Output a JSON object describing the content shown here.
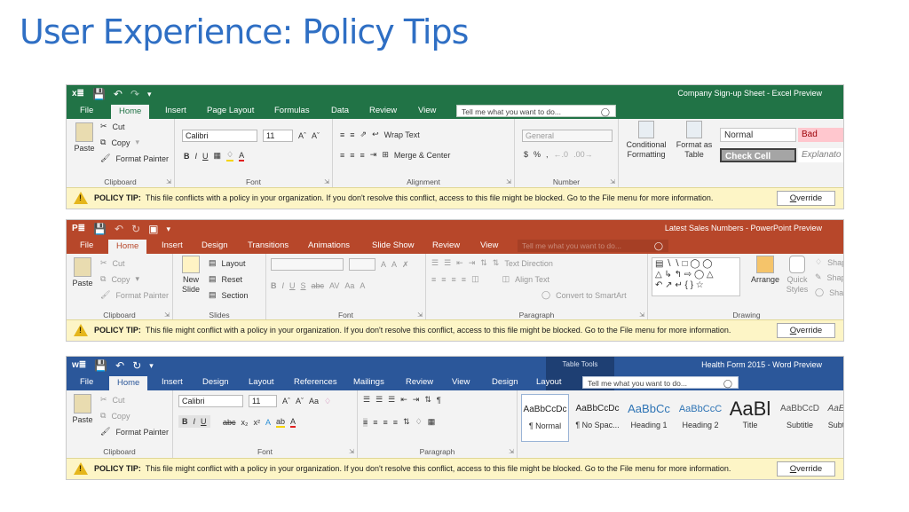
{
  "slide_title": "User Experience: Policy Tips",
  "excel": {
    "app_icon": "x≣",
    "window_title": "Company Sign-up Sheet - Excel Preview",
    "tabs": [
      "File",
      "Home",
      "Insert",
      "Page Layout",
      "Formulas",
      "Data",
      "Review",
      "View"
    ],
    "tell_me": "Tell me what you want to do...",
    "clipboard": {
      "paste": "Paste",
      "cut": "Cut",
      "copy": "Copy",
      "format_painter": "Format Painter",
      "label": "Clipboard"
    },
    "font": {
      "name": "Calibri",
      "size": "11",
      "label": "Font"
    },
    "alignment": {
      "wrap_text": "Wrap Text",
      "merge_center": "Merge & Center",
      "label": "Alignment"
    },
    "number": {
      "format": "General",
      "dollar": "$",
      "percent": "%",
      "comma": ",",
      "label": "Number"
    },
    "styles": {
      "conditional_formatting_line1": "Conditional",
      "conditional_formatting_line2": "Formatting",
      "format_as_table_line1": "Format as",
      "format_as_table_line2": "Table",
      "cell_styles": [
        "Normal",
        "Bad",
        "Check Cell",
        "Explanato"
      ]
    },
    "policy_tip": {
      "label": "POLICY TIP:",
      "message": "This file conflicts with a policy in your organization. If you don't resolve this conflict, access to this file might be blocked. Go to the File menu for more information.",
      "button": "Override"
    }
  },
  "powerpoint": {
    "app_icon": "P≣",
    "window_title": "Latest Sales Numbers - PowerPoint Preview",
    "tabs": [
      "File",
      "Home",
      "Insert",
      "Design",
      "Transitions",
      "Animations",
      "Slide Show",
      "Review",
      "View"
    ],
    "tell_me": "Tell me what you want to do...",
    "clipboard": {
      "paste": "Paste",
      "cut": "Cut",
      "copy": "Copy",
      "format_painter": "Format Painter",
      "label": "Clipboard"
    },
    "slides": {
      "new_slide_line1": "New",
      "new_slide_line2": "Slide",
      "layout": "Layout",
      "reset": "Reset",
      "section": "Section",
      "label": "Slides"
    },
    "font": {
      "label": "Font",
      "size_grow": "A",
      "size_shrink": "A",
      "char_spacing": "AV",
      "change_case": "Aa"
    },
    "paragraph": {
      "text_direction": "Text Direction",
      "align_text": "Align Text",
      "convert_smartart": "Convert to SmartArt",
      "label": "Paragraph"
    },
    "drawing": {
      "arrange": "Arrange",
      "quick_styles_line1": "Quick",
      "quick_styles_line2": "Styles",
      "shape_fill": "Shap",
      "shape_outline": "Shap",
      "shape_effects": "Shap",
      "label": "Drawing"
    },
    "policy_tip": {
      "label": "POLICY TIP:",
      "message": "This file might conflict with a policy in your organization. If you don't resolve this conflict, access to this file might be blocked. Go to the File menu for more information.",
      "button": "Override"
    }
  },
  "word": {
    "app_icon": "w≣",
    "contextual_group": "Table Tools",
    "window_title": "Health Form 2015 - Word Preview",
    "tabs": [
      "File",
      "Home",
      "Insert",
      "Design",
      "Layout",
      "References",
      "Mailings",
      "Review",
      "View",
      "Design",
      "Layout"
    ],
    "tell_me": "Tell me what you want to do...",
    "clipboard": {
      "paste": "Paste",
      "cut": "Cut",
      "copy": "Copy",
      "format_painter": "Format Painter",
      "label": "Clipboard"
    },
    "font": {
      "name": "Calibri",
      "size": "11",
      "label": "Font",
      "change_case": "Aa"
    },
    "paragraph": {
      "label": "Paragraph"
    },
    "styles": [
      {
        "preview": "AaBbCcDc",
        "name": "¶ Normal"
      },
      {
        "preview": "AaBbCcDc",
        "name": "¶ No Spac..."
      },
      {
        "preview": "AaBbCc",
        "name": "Heading 1"
      },
      {
        "preview": "AaBbCcC",
        "name": "Heading 2"
      },
      {
        "preview": "AaBl",
        "name": "Title"
      },
      {
        "preview": "AaBbCcD",
        "name": "Subtitle"
      },
      {
        "preview": "AaE",
        "name": "Subt"
      }
    ],
    "policy_tip": {
      "label": "POLICY TIP:",
      "message": "This file might conflict with a policy in your organization. If you don't resolve this conflict, access to this file might be blocked. Go to the File menu for more information.",
      "button": "Override"
    }
  },
  "colors": {
    "title_blue": "#2f6fc4",
    "excel_green": "#217346",
    "powerpoint_orange": "#b7472a",
    "word_blue": "#2b579a",
    "policy_tip_background": "#fdf5c6"
  }
}
